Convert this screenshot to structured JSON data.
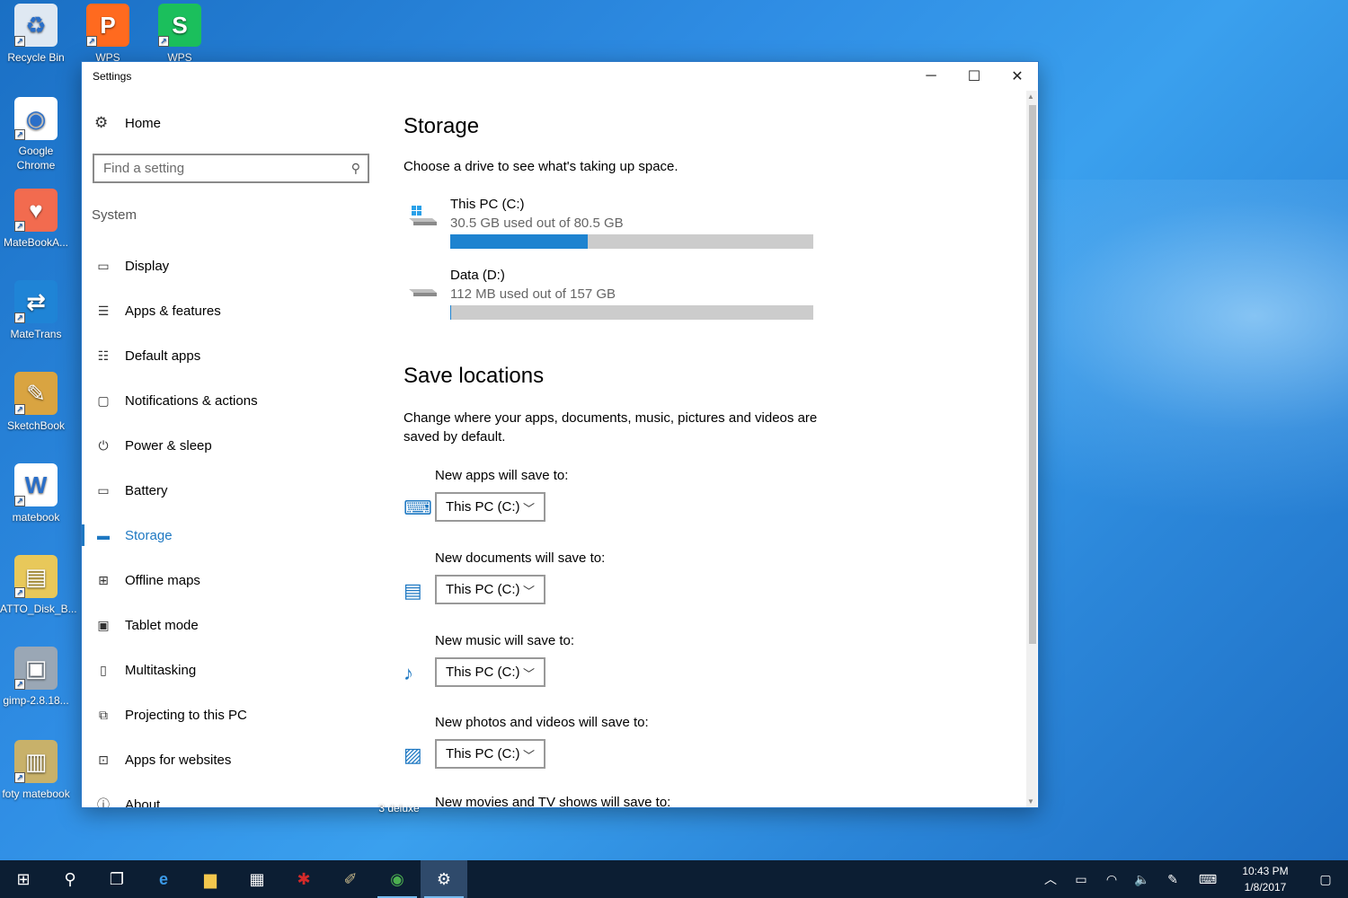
{
  "desktop": {
    "icons": [
      {
        "label": "Recycle Bin",
        "color": "#dfe8f2",
        "glyph": "♻"
      },
      {
        "label": "Google Chrome",
        "color": "#ffffff",
        "glyph": "◉"
      },
      {
        "label": "MateBookA...",
        "color": "#f26b4f",
        "glyph": "♥"
      },
      {
        "label": "MateTrans",
        "color": "#1f84d6",
        "glyph": "⇄"
      },
      {
        "label": "SketchBook",
        "color": "#d9a441",
        "glyph": "✎"
      },
      {
        "label": "matebook",
        "color": "#ffffff",
        "glyph": "W"
      },
      {
        "label": "ATTO_Disk_B...",
        "color": "#e8c85a",
        "glyph": "▤"
      },
      {
        "label": "gimp-2.8.18...",
        "color": "#9aa7b5",
        "glyph": "▣"
      },
      {
        "label": "foty matebook",
        "color": "#c8b16a",
        "glyph": "▥"
      },
      {
        "label": "WPS",
        "color": "#ff6a1f",
        "glyph": "P"
      },
      {
        "label": "WPS",
        "color": "#1bbf5c",
        "glyph": "S"
      }
    ],
    "partial_label": "3 deluxe"
  },
  "window": {
    "title": "Settings",
    "controls": {
      "minimize": "─",
      "maximize": "☐",
      "close": "✕"
    }
  },
  "nav": {
    "home": "Home",
    "search_placeholder": "Find a setting",
    "section": "System",
    "items": [
      {
        "label": "Display",
        "icon": "display-icon",
        "glyph": "▭"
      },
      {
        "label": "Apps & features",
        "icon": "apps-features-icon",
        "glyph": "☰"
      },
      {
        "label": "Default apps",
        "icon": "default-apps-icon",
        "glyph": "☷"
      },
      {
        "label": "Notifications & actions",
        "icon": "notifications-icon",
        "glyph": "▢"
      },
      {
        "label": "Power & sleep",
        "icon": "power-icon",
        "glyph": "⏻"
      },
      {
        "label": "Battery",
        "icon": "battery-icon",
        "glyph": "▭"
      },
      {
        "label": "Storage",
        "icon": "storage-icon",
        "glyph": "▬",
        "active": true
      },
      {
        "label": "Offline maps",
        "icon": "maps-icon",
        "glyph": "⊞"
      },
      {
        "label": "Tablet mode",
        "icon": "tablet-icon",
        "glyph": "▣"
      },
      {
        "label": "Multitasking",
        "icon": "multitasking-icon",
        "glyph": "▯"
      },
      {
        "label": "Projecting to this PC",
        "icon": "projecting-icon",
        "glyph": "⧉"
      },
      {
        "label": "Apps for websites",
        "icon": "apps-websites-icon",
        "glyph": "⊡"
      },
      {
        "label": "About",
        "icon": "about-icon",
        "glyph": "ⓘ"
      }
    ]
  },
  "main": {
    "title": "Storage",
    "subtitle": "Choose a drive to see what's taking up space.",
    "drives": [
      {
        "name": "This PC (C:)",
        "used": "30.5 GB used out of 80.5 GB",
        "fraction": 0.379
      },
      {
        "name": "Data (D:)",
        "used": "112 MB used out of 157 GB",
        "fraction": 0.0007
      }
    ],
    "save_title": "Save locations",
    "save_desc": "Change where your apps, documents, music, pictures and videos are saved by default.",
    "locations": [
      {
        "label": "New apps will save to:",
        "value": "This PC (C:)",
        "icon": "monitor-icon",
        "glyph": "⌨"
      },
      {
        "label": "New documents will save to:",
        "value": "This PC (C:)",
        "icon": "documents-icon",
        "glyph": "▤"
      },
      {
        "label": "New music will save to:",
        "value": "This PC (C:)",
        "icon": "music-icon",
        "glyph": "♪"
      },
      {
        "label": "New photos and videos will save to:",
        "value": "This PC (C:)",
        "icon": "photos-icon",
        "glyph": "▨"
      }
    ],
    "cut_label": "New movies and TV shows will save to:"
  },
  "taskbar": {
    "time": "10:43 PM",
    "date": "1/8/2017",
    "accent": "#0c1e33"
  }
}
